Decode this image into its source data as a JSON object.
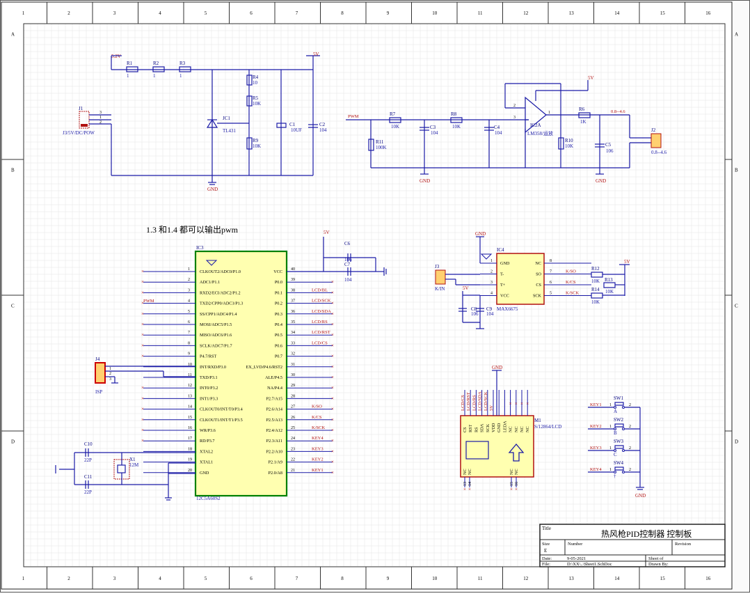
{
  "border": {
    "columns": [
      "1",
      "2",
      "3",
      "4",
      "5",
      "6",
      "7",
      "8",
      "9",
      "10",
      "11",
      "12",
      "13",
      "14",
      "15",
      "16"
    ],
    "rows": [
      "A",
      "B",
      "C",
      "D"
    ]
  },
  "annotation": "1.3 和1.4 都可以输出pwm",
  "power": {
    "v52": "5.2V",
    "v5": "5V",
    "gnd": "GND"
  },
  "left_circuit": {
    "resistors": [
      {
        "ref": "R1",
        "value": "1"
      },
      {
        "ref": "R2",
        "value": "1"
      },
      {
        "ref": "R3",
        "value": "1"
      },
      {
        "ref": "R4",
        "value": "10"
      },
      {
        "ref": "R5",
        "value": "10K"
      },
      {
        "ref": "R9",
        "value": "10K"
      }
    ],
    "jc1": {
      "ref": "JC1",
      "value": "TL431"
    },
    "c1": {
      "ref": "C1",
      "value": "10UF"
    },
    "c2": {
      "ref": "C2",
      "value": "104"
    },
    "j1": {
      "ref": "J1",
      "value": "J3/5V/DC/POW"
    }
  },
  "right_circuit": {
    "pwm": "PWM",
    "r7": {
      "ref": "R7",
      "value": "10K"
    },
    "r8": {
      "ref": "R8",
      "value": "10K"
    },
    "r11": {
      "ref": "R11",
      "value": "100K"
    },
    "c3": {
      "ref": "C3",
      "value": "104"
    },
    "c4": {
      "ref": "C4",
      "value": "104"
    },
    "ic2": {
      "ref": "IC2A",
      "value": "LM358/运放"
    },
    "r6": {
      "ref": "R6",
      "value": "1K"
    },
    "r10": {
      "ref": "R10",
      "value": "10K"
    },
    "c5": {
      "ref": "C5",
      "value": "106"
    },
    "range": "0.8--4.6",
    "j2": {
      "ref": "J2",
      "value": "0.8--4.6"
    }
  },
  "mcu": {
    "ref": "IC3",
    "part": "12C5A60S2",
    "left_pins": [
      {
        "num": "1",
        "name": "CLKOUT2/ADC0/P1.0"
      },
      {
        "num": "2",
        "name": "ADC1/P1.1"
      },
      {
        "num": "3",
        "name": "RXD2/ECI/ADC2/P1.2"
      },
      {
        "num": "4",
        "name": "TXD2/CPP0/ADC3/P1.3"
      },
      {
        "num": "5",
        "name": "SS/CPP1/ADC4/P1.4"
      },
      {
        "num": "6",
        "name": "MOSI/ADC5/P1.5"
      },
      {
        "num": "7",
        "name": "MISO/ADC6/P1.6"
      },
      {
        "num": "8",
        "name": "SCLK/ADC7/P1.7"
      },
      {
        "num": "9",
        "name": "P4.7/RST"
      },
      {
        "num": "10",
        "name": "INT/RXD/P3.0"
      },
      {
        "num": "11",
        "name": "TXD/P3.1"
      },
      {
        "num": "12",
        "name": "INT0/P3.2"
      },
      {
        "num": "13",
        "name": "INT1/P3.3"
      },
      {
        "num": "14",
        "name": "CLKOUT0/INT/T0/P3.4"
      },
      {
        "num": "15",
        "name": "CLKOUT1/INT/T1/P3.5"
      },
      {
        "num": "16",
        "name": "WR/P3.6"
      },
      {
        "num": "17",
        "name": "RD/P3.7"
      },
      {
        "num": "18",
        "name": "XTAL2"
      },
      {
        "num": "19",
        "name": "XTAL1"
      },
      {
        "num": "20",
        "name": "GND"
      }
    ],
    "right_pins": [
      {
        "num": "40",
        "name": "VCC",
        "net": ""
      },
      {
        "num": "39",
        "name": "P0.0",
        "net": ""
      },
      {
        "num": "38",
        "name": "P0.1",
        "net": "LCD/BL"
      },
      {
        "num": "37",
        "name": "P0.2",
        "net": "LCD/SCK"
      },
      {
        "num": "36",
        "name": "P0.3",
        "net": "LCD/SDA"
      },
      {
        "num": "35",
        "name": "P0.4",
        "net": "LCD/RS"
      },
      {
        "num": "34",
        "name": "P0.5",
        "net": "LCD/RST"
      },
      {
        "num": "33",
        "name": "P0.6",
        "net": "LCD/CS"
      },
      {
        "num": "32",
        "name": "P0.7",
        "net": ""
      },
      {
        "num": "31",
        "name": "EX_LVD/P4.6/RST2",
        "net": ""
      },
      {
        "num": "30",
        "name": "ALE/P4.5",
        "net": ""
      },
      {
        "num": "29",
        "name": "NA/P4.4",
        "net": ""
      },
      {
        "num": "28",
        "name": "P2.7/A15",
        "net": ""
      },
      {
        "num": "27",
        "name": "P2.6/A14",
        "net": "K/SO"
      },
      {
        "num": "26",
        "name": "P2.5/A13",
        "net": "K/CS"
      },
      {
        "num": "25",
        "name": "P2.4/A12",
        "net": "K/SCK"
      },
      {
        "num": "24",
        "name": "P2.3/A11",
        "net": "KEY4"
      },
      {
        "num": "23",
        "name": "P2.2/A10",
        "net": "KEY3"
      },
      {
        "num": "22",
        "name": "P2.1/A9",
        "net": "KEY2"
      },
      {
        "num": "21",
        "name": "P2.0/A8",
        "net": "KEY1"
      }
    ],
    "pwm_net": "PWM",
    "c6": {
      "ref": "C6",
      "value": "106"
    },
    "c7": {
      "ref": "C7",
      "value": "104"
    },
    "isp": {
      "ref": "J4",
      "value": "ISP"
    },
    "c10": {
      "ref": "C10",
      "value": "22P"
    },
    "c11": {
      "ref": "C11",
      "value": "22P"
    },
    "x1": {
      "ref": "X1",
      "value": "12M"
    }
  },
  "max6675": {
    "ref": "IC4",
    "part": "MAX6675",
    "left_pins": [
      {
        "num": "1",
        "name": "GND"
      },
      {
        "num": "2",
        "name": "T-"
      },
      {
        "num": "3",
        "name": "T+"
      },
      {
        "num": "4",
        "name": "VCC"
      }
    ],
    "right_pins": [
      {
        "num": "8",
        "name": "NC",
        "net": ""
      },
      {
        "num": "7",
        "name": "SO",
        "net": "K/SO"
      },
      {
        "num": "6",
        "name": "CS",
        "net": "K/CS"
      },
      {
        "num": "5",
        "name": "SCK",
        "net": "K/SCK"
      }
    ],
    "j3": {
      "ref": "J3",
      "value": "K/IN"
    },
    "r12": {
      "ref": "R12",
      "value": "10K"
    },
    "r13": {
      "ref": "R13",
      "value": "10K"
    },
    "r14": {
      "ref": "R14",
      "value": "10K"
    },
    "c8": {
      "ref": "C8",
      "value": "106"
    },
    "c9": {
      "ref": "C9",
      "value": "104"
    }
  },
  "lcd": {
    "ref": "M1",
    "part": "S/12864/LCD",
    "top_pins": [
      "CS",
      "RST",
      "RS",
      "SDA",
      "SCK",
      "VDD",
      "GND",
      "LEDA",
      "NC",
      "NC",
      "NC",
      "NC"
    ],
    "top_nets": [
      "LCD/CS",
      "LCD/RST",
      "LCD/RS",
      "LCD/SDA",
      "LCD/SCK",
      "5V"
    ],
    "bottom_pins": [
      "NC",
      "NC",
      "NC",
      "NC"
    ],
    "bottom_nums": [
      "13",
      "14",
      "15",
      "16"
    ]
  },
  "keys": [
    {
      "net": "KEY1",
      "ref": "SW1",
      "label": "A"
    },
    {
      "net": "KEY2",
      "ref": "SW2",
      "label": "B"
    },
    {
      "net": "KEY3",
      "ref": "SW3",
      "label": "C"
    },
    {
      "net": "KEY4",
      "ref": "SW4",
      "label": "†"
    }
  ],
  "title_block": {
    "title_label": "Title",
    "title": "热风枪PID控制器 控制板",
    "size_label": "Size",
    "size": "E",
    "number_label": "Number",
    "revision_label": "Revision",
    "date_label": "Date:",
    "date": "9-05-2021",
    "file_label": "File:",
    "file": "D:\\XX\\..\\Sheet1.SchDoc",
    "sheet_label": "Sheet   of",
    "drawn_label": "Drawn By:"
  }
}
